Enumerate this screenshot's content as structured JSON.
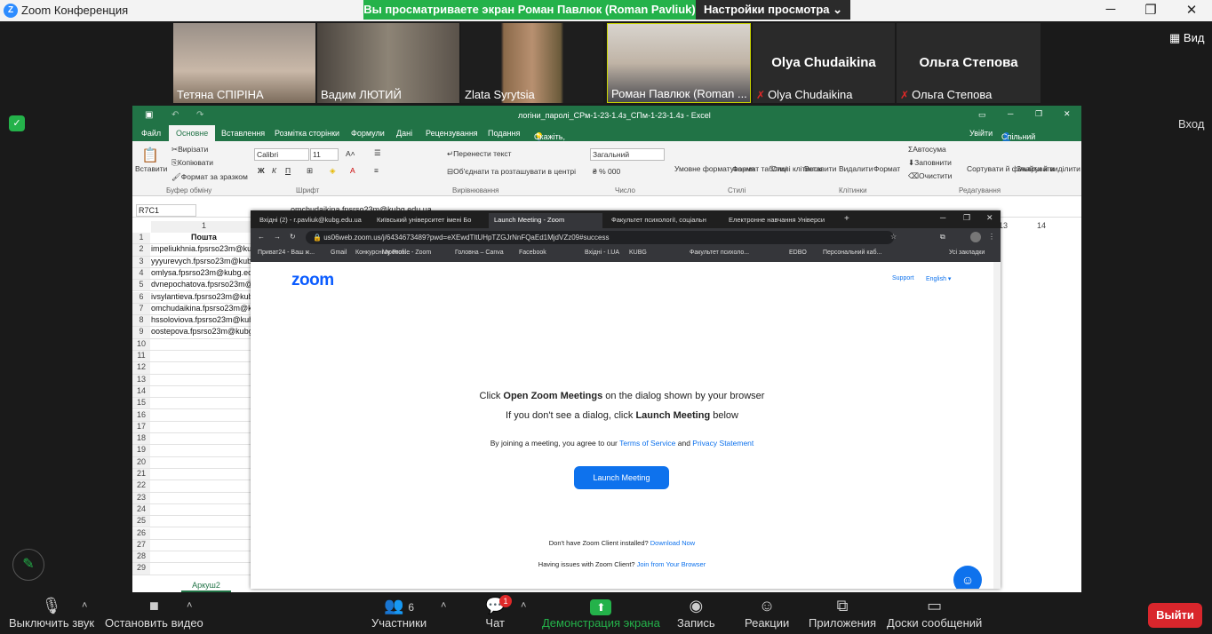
{
  "zoom": {
    "title": "Zoom Конференция",
    "share_text": "Вы просматриваете экран Роман Павлюк (Roman Pavliuk)",
    "view_settings": "Настройки просмотра",
    "view": "Вид",
    "login": "Вход"
  },
  "participants": [
    {
      "name": "Тетяна СПІРІНА",
      "muted": false
    },
    {
      "name": "Вадим ЛЮТИЙ",
      "muted": false
    },
    {
      "name": "Zlata Syrytsia",
      "muted": false
    },
    {
      "name": "Роман Павлюк (Roman ...",
      "muted": false
    },
    {
      "big": "Olya Chudaikina",
      "name": "Olya Chudaikina",
      "muted": true
    },
    {
      "big": "Ольга Степова",
      "name": "Ольга Степова",
      "muted": true
    }
  ],
  "excel": {
    "title": "логіни_паролі_СРм-1-23-1.4з_СПм-1-23-1.4з - Excel",
    "menu": [
      "Файл",
      "Основне",
      "Вставлення",
      "Розмітка сторінки",
      "Формули",
      "Дані",
      "Рецензування",
      "Подання"
    ],
    "tell_me": "Скажіть, що потрібно зробити...",
    "signin": "Увійти",
    "share": "Спільний доступ",
    "ribbon": {
      "paste": "Вставити",
      "cut": "Вирізати",
      "copy": "Копіювати",
      "format_painter": "Формат за зразком",
      "clipboard": "Буфер обміну",
      "font_name": "Calibri",
      "font_size": "11",
      "font_group": "Шрифт",
      "wrap": "Перенести текст",
      "merge": "Об'єднати та розташувати в центрі",
      "align_group": "Вирівнювання",
      "number_format": "Загальний",
      "number_group": "Число",
      "cond": "Умовне форматування",
      "fmt_table": "Формат таблиці",
      "cell_styles": "Стилі клітинок",
      "styles_group": "Стилі",
      "insert": "Вставити",
      "delete": "Видалити",
      "format": "Формат",
      "cells_group": "Клітинки",
      "autosum": "Автосума",
      "fill": "Заповнити",
      "clear": "Очистити",
      "sort": "Сортувати й фільтрувати",
      "find": "Знайти й виділити",
      "edit_group": "Редагування"
    },
    "name_box": "R7C1",
    "formula": "omchudaikina.fpsrso23m@kubg.edu.ua",
    "col_header": "1",
    "col13": "13",
    "col14": "14",
    "header_cell": "Пошта",
    "rows": [
      "impeliukhnia.fpsrso23m@kubg",
      "yyyurevych.fpsrso23m@kubg",
      "omlysa.fpsrso23m@kubg.edu",
      "dvnepochatova.fpsrso23m@k",
      "ivsylantieva.fpsrso23m@kubg",
      "omchudaikina.fpsrso23m@kubg",
      "hssoloviova.fpsrso23m@kubg",
      "oostepova.fpsrso23m@kubg"
    ],
    "empty_rows": [
      "10",
      "11",
      "12",
      "13",
      "14",
      "15",
      "16",
      "17",
      "18",
      "19",
      "20",
      "21",
      "22",
      "23",
      "24",
      "25",
      "26",
      "27",
      "28",
      "29"
    ],
    "sheet_tab": "Аркуш2"
  },
  "chrome": {
    "tabs": [
      "Вхідні (2) - r.pavliuk@kubg.edu.ua",
      "Київський університет імені Бо",
      "Launch Meeting - Zoom",
      "Факультет психології, соціальн",
      "Електронне навчання Універси"
    ],
    "url": "us06web.zoom.us/j/6434673489?pwd=eXEwdTltUHpTZGJrNnFQaEd1MjdVZz09#success",
    "bookmarks": [
      "Приват24 - Ваш ж...",
      "Gmail",
      "Конкурсні пропоз...",
      "My Profile - Zoom",
      "Головна – Canva",
      "Facebook",
      "Вхідні - I.UA",
      "KUBG",
      "Факультет психоло...",
      "EDBO",
      "Персональний каб...",
      "Усі закладки"
    ]
  },
  "zoompage": {
    "logo": "zoom",
    "support": "Support",
    "lang": "English",
    "line1_pre": "Click ",
    "line1_bold": "Open Zoom Meetings",
    "line1_post": " on the dialog shown by your browser",
    "line2_pre": "If you don't see a dialog, click ",
    "line2_bold": "Launch Meeting",
    "line2_post": " below",
    "terms_pre": "By joining a meeting, you agree to our ",
    "terms": "Terms of Service",
    "and": " and ",
    "privacy": "Privacy Statement",
    "launch": "Launch Meeting",
    "dl_pre": "Don't have Zoom Client installed? ",
    "dl": "Download Now",
    "br_pre": "Having issues with Zoom Client? ",
    "br": "Join from Your Browser"
  },
  "toolbar": {
    "mute": "Выключить звук",
    "video": "Остановить видео",
    "participants": "Участники",
    "participants_count": "6",
    "chat": "Чат",
    "chat_badge": "1",
    "share": "Демонстрация экрана",
    "record": "Запись",
    "reactions": "Реакции",
    "apps": "Приложения",
    "whiteboard": "Доски сообщений",
    "leave": "Выйти"
  }
}
